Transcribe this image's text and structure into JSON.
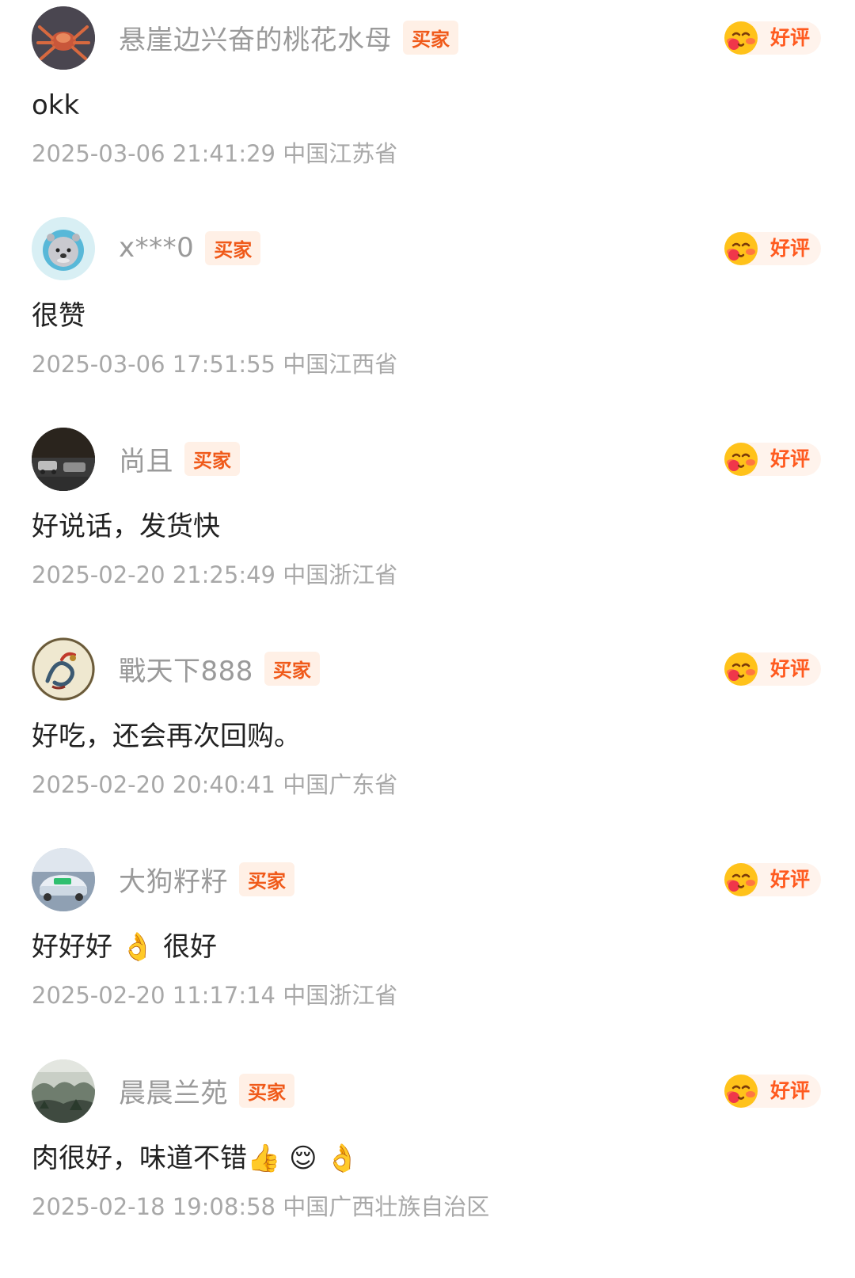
{
  "colors": {
    "buyer_badge_text": "#f05a1a",
    "buyer_badge_bg": "#fff0e6",
    "rating_text": "#ff5a1f",
    "rating_bg": "#fff3ec",
    "username": "#9a9a9a",
    "comment": "#222222",
    "meta": "#a8a8a8"
  },
  "reviews": [
    {
      "username": "悬崖边兴奋的桃花水母",
      "buyer_badge": "买家",
      "rating": "好评",
      "rating_icon": "blushing-face-icon",
      "comment": "okk",
      "datetime": "2025-03-06 21:41:29",
      "location": "中国江苏省"
    },
    {
      "username": "x***0",
      "buyer_badge": "买家",
      "rating": "好评",
      "rating_icon": "blushing-face-icon",
      "comment": "很赞",
      "datetime": "2025-03-06 17:51:55",
      "location": "中国江西省"
    },
    {
      "username": "尚且",
      "buyer_badge": "买家",
      "rating": "好评",
      "rating_icon": "blushing-face-icon",
      "comment": "好说话，发货快",
      "datetime": "2025-02-20 21:25:49",
      "location": "中国浙江省"
    },
    {
      "username": "戰天下888",
      "buyer_badge": "买家",
      "rating": "好评",
      "rating_icon": "blushing-face-icon",
      "comment": "好吃，还会再次回购。",
      "datetime": "2025-02-20 20:40:41",
      "location": "中国广东省"
    },
    {
      "username": "大狗籽籽",
      "buyer_badge": "买家",
      "rating": "好评",
      "rating_icon": "blushing-face-icon",
      "comment": "好好好 👌 很好",
      "datetime": "2025-02-20 11:17:14",
      "location": "中国浙江省"
    },
    {
      "username": "晨晨兰苑",
      "buyer_badge": "买家",
      "rating": "好评",
      "rating_icon": "blushing-face-icon",
      "comment": "肉很好，味道不错👍 😌 👌",
      "datetime": "2025-02-18 19:08:58",
      "location": "中国广西壮族自治区"
    }
  ]
}
